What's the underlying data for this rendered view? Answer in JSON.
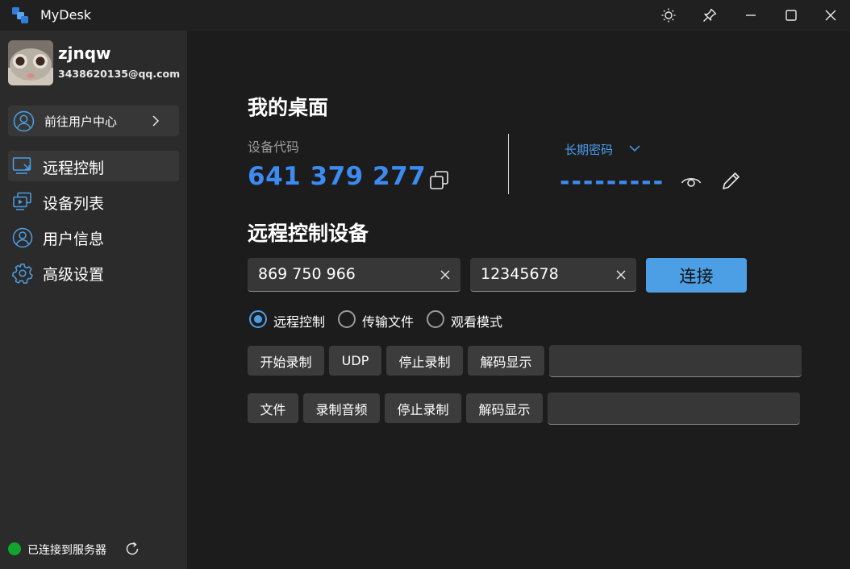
{
  "window": {
    "title": "MyDesk",
    "controls": [
      "theme-icon",
      "pin-icon",
      "minimize-icon",
      "maximize-icon",
      "close-icon"
    ]
  },
  "sidebar": {
    "user": {
      "name": "zjnqw",
      "email": "3438620135@qq.com"
    },
    "user_center": {
      "label": "前往用户中心"
    },
    "nav": [
      {
        "label": "远程控制",
        "icon": "remote-control-icon",
        "active": true
      },
      {
        "label": "设备列表",
        "icon": "device-list-icon",
        "active": false
      },
      {
        "label": "用户信息",
        "icon": "user-icon",
        "active": false
      },
      {
        "label": "高级设置",
        "icon": "gear-icon",
        "active": false
      }
    ],
    "status": {
      "text": "已连接到服务器",
      "color": "#11a52e"
    }
  },
  "my_desktop": {
    "title": "我的桌面",
    "device_code_label": "设备代码",
    "device_code": "641 379 277",
    "password_type": "长期密码",
    "password_mask": "---------"
  },
  "remote": {
    "title": "远程控制设备",
    "device_input": "869 750 966",
    "password_input": "12345678",
    "connect_label": "连接",
    "modes": [
      {
        "label": "远程控制",
        "selected": true
      },
      {
        "label": "传输文件",
        "selected": false
      },
      {
        "label": "观看模式",
        "selected": false
      }
    ],
    "row1": [
      "开始录制",
      "UDP",
      "停止录制",
      "解码显示"
    ],
    "row2": [
      "文件",
      "录制音频",
      "停止录制",
      "解码显示"
    ]
  },
  "colors": {
    "accent": "#4c9fe5",
    "code": "#3d8bf0",
    "sidebar": "#2b2b2b",
    "background": "#1c1c1c"
  }
}
